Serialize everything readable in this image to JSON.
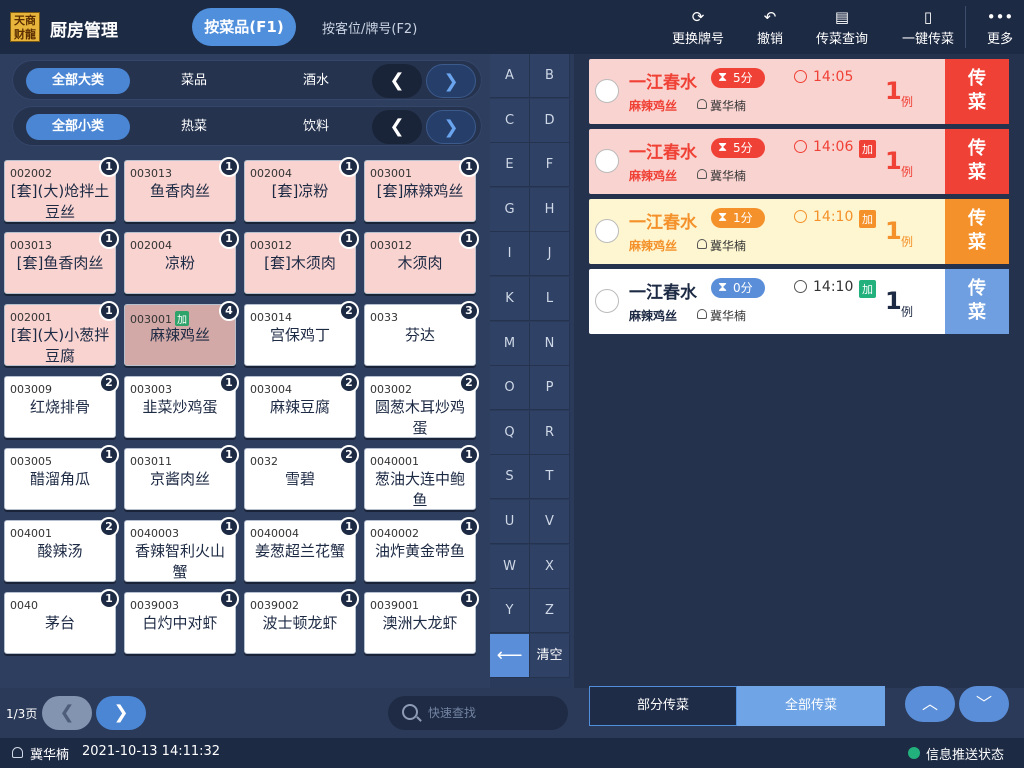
{
  "app": {
    "logo_text": "天商\n财龍",
    "title": "厨房管理"
  },
  "tabs": {
    "by_dish": "按菜品(F1)",
    "by_table": "按客位/牌号(F2)"
  },
  "toolbar": [
    {
      "icon": "refresh-icon",
      "label": "更换牌号"
    },
    {
      "icon": "undo-icon",
      "label": "撤销"
    },
    {
      "icon": "doc-search-icon",
      "label": "传菜查询"
    },
    {
      "icon": "clipboard-icon",
      "label": "一键传菜"
    },
    {
      "icon": "more-icon",
      "label": "更多"
    }
  ],
  "filters": {
    "category": [
      "全部大类",
      "菜品",
      "酒水"
    ],
    "subcategory": [
      "全部小类",
      "热菜",
      "饮料"
    ]
  },
  "dishes": [
    {
      "code": "002002",
      "name": "[套](大)炝拌土豆丝",
      "count": "1",
      "style": "pink"
    },
    {
      "code": "003013",
      "name": "鱼香肉丝",
      "count": "1",
      "style": "pink"
    },
    {
      "code": "002004",
      "name": "[套]凉粉",
      "count": "1",
      "style": "pink"
    },
    {
      "code": "003001",
      "name": "[套]麻辣鸡丝",
      "count": "1",
      "style": "pink"
    },
    {
      "code": "003013",
      "name": "[套]鱼香肉丝",
      "count": "1",
      "style": "pink"
    },
    {
      "code": "002004",
      "name": "凉粉",
      "count": "1",
      "style": "pink"
    },
    {
      "code": "003012",
      "name": "[套]木须肉",
      "count": "1",
      "style": "pink"
    },
    {
      "code": "003012",
      "name": "木须肉",
      "count": "1",
      "style": "pink"
    },
    {
      "code": "002001",
      "name": "[套](大)小葱拌豆腐",
      "count": "1",
      "style": "pink"
    },
    {
      "code": "003001",
      "name": "麻辣鸡丝",
      "count": "4",
      "style": "dark",
      "tag": "加"
    },
    {
      "code": "003014",
      "name": "宫保鸡丁",
      "count": "2",
      "style": "white"
    },
    {
      "code": "0033",
      "name": "芬达",
      "count": "3",
      "style": "white"
    },
    {
      "code": "003009",
      "name": "红烧排骨",
      "count": "2",
      "style": "white"
    },
    {
      "code": "003003",
      "name": "韭菜炒鸡蛋",
      "count": "1",
      "style": "white"
    },
    {
      "code": "003004",
      "name": "麻辣豆腐",
      "count": "2",
      "style": "white"
    },
    {
      "code": "003002",
      "name": "圆葱木耳炒鸡蛋",
      "count": "2",
      "style": "white"
    },
    {
      "code": "003005",
      "name": "醋溜角瓜",
      "count": "1",
      "style": "white"
    },
    {
      "code": "003011",
      "name": "京酱肉丝",
      "count": "1",
      "style": "white"
    },
    {
      "code": "0032",
      "name": "雪碧",
      "count": "2",
      "style": "white"
    },
    {
      "code": "0040001",
      "name": "葱油大连中鲍鱼",
      "count": "1",
      "style": "white"
    },
    {
      "code": "004001",
      "name": "酸辣汤",
      "count": "2",
      "style": "white"
    },
    {
      "code": "0040003",
      "name": "香辣智利火山蟹",
      "count": "1",
      "style": "white"
    },
    {
      "code": "0040004",
      "name": "姜葱超兰花蟹",
      "count": "1",
      "style": "white"
    },
    {
      "code": "0040002",
      "name": "油炸黄金带鱼",
      "count": "1",
      "style": "white"
    },
    {
      "code": "0040",
      "name": "茅台",
      "count": "1",
      "style": "white"
    },
    {
      "code": "0039003",
      "name": "白灼中对虾",
      "count": "1",
      "style": "white"
    },
    {
      "code": "0039002",
      "name": "波士顿龙虾",
      "count": "1",
      "style": "white"
    },
    {
      "code": "0039001",
      "name": "澳洲大龙虾",
      "count": "1",
      "style": "white"
    }
  ],
  "alphabet": [
    "A",
    "B",
    "C",
    "D",
    "E",
    "F",
    "G",
    "H",
    "I",
    "J",
    "K",
    "L",
    "M",
    "N",
    "O",
    "P",
    "Q",
    "R",
    "S",
    "T",
    "U",
    "V",
    "W",
    "X",
    "Y",
    "Z"
  ],
  "alpha_clear": "清空",
  "pager": {
    "page": "1/3页"
  },
  "search": {
    "placeholder": "快速查找"
  },
  "orders": [
    {
      "table": "一江春水",
      "timer": "5分",
      "time": "14:05",
      "added": "",
      "dish": "麻辣鸡丝",
      "user": "冀华楠",
      "qty": "1",
      "unit": "例",
      "action": "传菜",
      "style": "red"
    },
    {
      "table": "一江春水",
      "timer": "5分",
      "time": "14:06",
      "added": "加",
      "dish": "麻辣鸡丝",
      "user": "冀华楠",
      "qty": "1",
      "unit": "例",
      "action": "传菜",
      "style": "red"
    },
    {
      "table": "一江春水",
      "timer": "1分",
      "time": "14:10",
      "added": "加",
      "dish": "麻辣鸡丝",
      "user": "冀华楠",
      "qty": "1",
      "unit": "例",
      "action": "传菜",
      "style": "yellow"
    },
    {
      "table": "一江春水",
      "timer": "0分",
      "time": "14:10",
      "added": "加",
      "dish": "麻辣鸡丝",
      "user": "冀华楠",
      "qty": "1",
      "unit": "例",
      "action": "传菜",
      "style": "white"
    }
  ],
  "footer": {
    "partial": "部分传菜",
    "all": "全部传菜"
  },
  "status": {
    "user": "冀华楠",
    "datetime": "2021-10-13 14:11:32",
    "message": "信息推送状态"
  },
  "colors": {
    "red": "#f04136",
    "orange": "#f4912a",
    "blue": "#5a8ed8",
    "dark_navy": "#1d2a44"
  }
}
